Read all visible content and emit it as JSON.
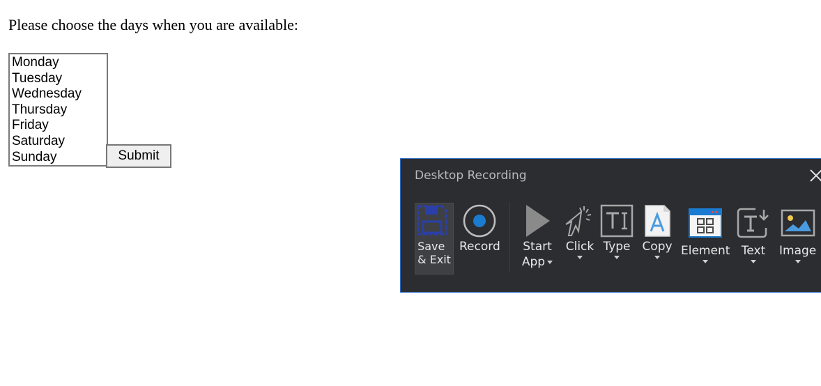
{
  "form": {
    "prompt": "Please choose the days when you are available:",
    "days": [
      "Monday",
      "Tuesday",
      "Wednesday",
      "Thursday",
      "Friday",
      "Saturday",
      "Sunday"
    ],
    "submit_label": "Submit"
  },
  "recording_panel": {
    "title": "Desktop Recording",
    "tools": {
      "save_exit": {
        "line1": "Save",
        "line2": "& Exit",
        "icon": "floppy-disk-icon"
      },
      "record": {
        "label": "Record",
        "icon": "record-icon"
      },
      "start_app": {
        "line1": "Start",
        "line2": "App",
        "icon": "play-icon"
      },
      "click": {
        "label": "Click",
        "icon": "cursor-click-icon"
      },
      "type": {
        "label": "Type",
        "icon": "text-input-icon"
      },
      "copy": {
        "label": "Copy",
        "icon": "copy-text-icon"
      },
      "element": {
        "label": "Element",
        "icon": "window-element-icon"
      },
      "text": {
        "label": "Text",
        "icon": "text-action-icon"
      },
      "image": {
        "label": "Image",
        "icon": "image-icon"
      }
    },
    "colors": {
      "background": "#2c2d31",
      "border": "#2f6fc8",
      "accent_blue": "#1a7bd1",
      "save_icon": "#2a3fa8"
    }
  }
}
